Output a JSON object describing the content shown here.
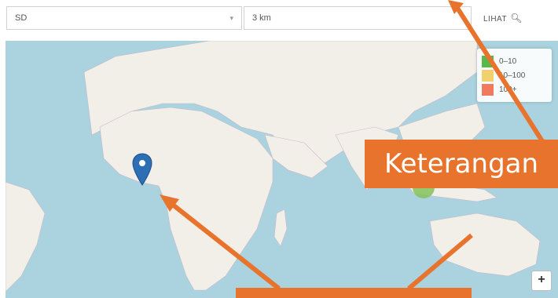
{
  "filters": {
    "level_value": "SD",
    "radius_value": "3 km",
    "search_label": "LIHAT"
  },
  "legend": {
    "items": [
      {
        "label": "0–10",
        "color": "#59b84a"
      },
      {
        "label": "10–100",
        "color": "#f1d16b"
      },
      {
        "label": "100+",
        "color": "#f07a5c"
      }
    ]
  },
  "map": {
    "marker_color": "#2d6fb5",
    "land_color": "#f2efe9",
    "water_color": "#aad3df",
    "cluster_color": "#84c25b"
  },
  "zoom": {
    "in_label": "+"
  },
  "callouts": {
    "legend_callout": "Keterangan",
    "accent": "#e8732c"
  }
}
